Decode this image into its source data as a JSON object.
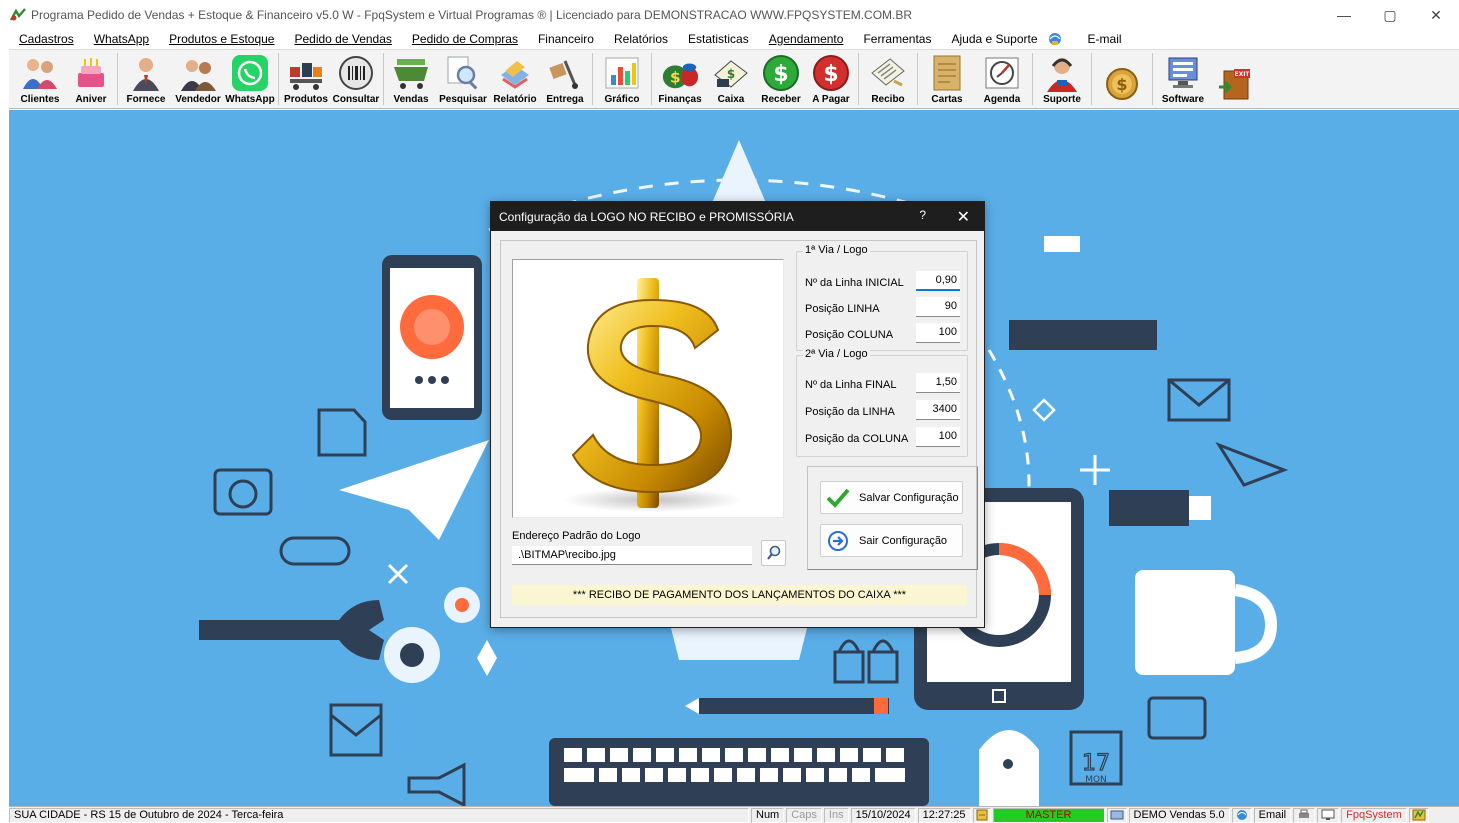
{
  "window": {
    "title": "Programa Pedido de Vendas + Estoque & Financeiro v5.0 W - FpqSystem e Virtual Programas ® | Licenciado para  DEMONSTRACAO WWW.FPQSYSTEM.COM.BR",
    "min": "—",
    "max": "▢",
    "close": "✕"
  },
  "menu": [
    "Cadastros",
    "WhatsApp",
    "Produtos e Estoque",
    "Pedido de Vendas",
    "Pedido de Compras",
    "Financeiro",
    "Relatórios",
    "Estatisticas",
    "Agendamento",
    "Ferramentas",
    "Ajuda e Suporte",
    "E-mail"
  ],
  "toolbar": [
    {
      "label": "Clientes",
      "icon": "clients-icon"
    },
    {
      "label": "Aniver",
      "icon": "birthday-cake-icon"
    },
    {
      "label": "Fornece",
      "icon": "supplier-icon"
    },
    {
      "label": "Vendedor",
      "icon": "seller-icon"
    },
    {
      "label": "WhatsApp",
      "icon": "whatsapp-icon"
    },
    {
      "label": "Produtos",
      "icon": "products-icon"
    },
    {
      "label": "Consultar",
      "icon": "barcode-icon"
    },
    {
      "label": "Vendas",
      "icon": "cart-icon"
    },
    {
      "label": "Pesquisar",
      "icon": "magnifier-icon"
    },
    {
      "label": "Relatório",
      "icon": "report-icon"
    },
    {
      "label": "Entrega",
      "icon": "delivery-icon"
    },
    {
      "label": "Gráfico",
      "icon": "chart-icon"
    },
    {
      "label": "Finanças",
      "icon": "money-bag-icon"
    },
    {
      "label": "Caixa",
      "icon": "cash-register-icon"
    },
    {
      "label": "Receber",
      "icon": "receive-dollar-icon"
    },
    {
      "label": "A Pagar",
      "icon": "pay-dollar-icon"
    },
    {
      "label": "Recibo",
      "icon": "receipt-icon"
    },
    {
      "label": "Cartas",
      "icon": "letters-icon"
    },
    {
      "label": "Agenda",
      "icon": "agenda-icon"
    },
    {
      "label": "Suporte",
      "icon": "support-icon"
    },
    {
      "label": "",
      "icon": "coin-icon"
    },
    {
      "label": "Software",
      "icon": "software-icon"
    },
    {
      "label": "",
      "icon": "exit-icon"
    }
  ],
  "dialog": {
    "title": "Configuração da LOGO NO RECIBO e PROMISSÓRIA",
    "help": "?",
    "close": "✕",
    "via1": {
      "title": "1ª Via / Logo",
      "fields": [
        {
          "label": "Nº da Linha INICIAL",
          "value": "0,90"
        },
        {
          "label": "Posição LINHA",
          "value": "90"
        },
        {
          "label": "Posição COLUNA",
          "value": "100"
        }
      ]
    },
    "via2": {
      "title": "2ª Via / Logo",
      "fields": [
        {
          "label": "Nº da Linha FINAL",
          "value": "1,50"
        },
        {
          "label": "Posição da LINHA",
          "value": "3400"
        },
        {
          "label": "Posição da COLUNA",
          "value": "100"
        }
      ]
    },
    "save_label": "Salvar Configuração",
    "exit_label": "Sair Configuração",
    "address_label": "Endereço Padrão do Logo",
    "address_value": ".\\BITMAP\\recibo.jpg",
    "footer": "*** RECIBO DE PAGAMENTO DOS LANÇAMENTOS DO CAIXA ***"
  },
  "status": {
    "city": "SUA CIDADE - RS 15 de Outubro de 2024 - Terca-feira",
    "num": "Num",
    "caps": "Caps",
    "ins": "Ins",
    "date": "15/10/2024",
    "time": "12:27:25",
    "user": "MASTER",
    "demo": "DEMO Vendas 5.0",
    "email": "Email",
    "brand": "FpqSystem"
  },
  "colors": {
    "desktop": "#5aaee8",
    "user_badge": "#22cc22",
    "brand": "#d03030"
  }
}
